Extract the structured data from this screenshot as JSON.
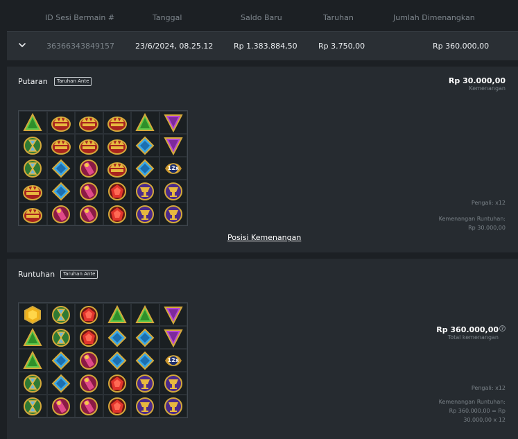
{
  "table": {
    "headers": [
      "ID Sesi Bermain #",
      "Tanggal",
      "Saldo Baru",
      "Taruhan",
      "Jumlah Dimenangkan"
    ],
    "row": {
      "id": "36366343849157",
      "date": "23/6/2024, 08.25.12",
      "balance": "Rp 1.383.884,50",
      "bet": "Rp 3.750,00",
      "won": "Rp 360.000,00"
    }
  },
  "spin": {
    "title": "Putaran",
    "badge": "Taruhan Ante",
    "win_amount": "Rp 30.000,00",
    "win_label": "Kemenangan",
    "multiplier": "Pengali: x12",
    "cascade_label": "Kemenangan Runtuhan:",
    "cascade_value": "Rp 30.000,00",
    "link": "Posisi Kemenangan",
    "grid": [
      [
        "green-triangle",
        "crown",
        "crown",
        "crown",
        "green-triangle",
        "purple-triangle"
      ],
      [
        "hourglass",
        "crown",
        "crown",
        "crown",
        "blue-diamond",
        "purple-triangle"
      ],
      [
        "hourglass",
        "blue-diamond",
        "ring",
        "crown",
        "blue-diamond",
        "multiplier"
      ],
      [
        "crown",
        "blue-diamond",
        "ring",
        "red-gem",
        "chalice",
        "chalice"
      ],
      [
        "crown",
        "ring",
        "ring",
        "red-gem",
        "chalice",
        "chalice"
      ]
    ],
    "multiplier_symbol": "12x"
  },
  "tumble": {
    "title": "Runtuhan",
    "badge": "Taruhan Ante",
    "total_amount": "Rp 360.000,00",
    "total_label": "Total kemenangan",
    "help": "?",
    "multiplier": "Pengali: x12",
    "cascade_label": "Kemenangan Runtuhan:",
    "cascade_line1": "Rp 360.000,00 = Rp",
    "cascade_line2": "30.000,00 x 12",
    "grid": [
      [
        "yellow-gem",
        "hourglass",
        "red-gem",
        "green-triangle",
        "green-triangle",
        "purple-triangle"
      ],
      [
        "green-triangle",
        "hourglass",
        "red-gem",
        "blue-diamond",
        "blue-diamond",
        "purple-triangle"
      ],
      [
        "green-triangle",
        "blue-diamond",
        "ring",
        "blue-diamond",
        "blue-diamond",
        "multiplier"
      ],
      [
        "hourglass",
        "blue-diamond",
        "ring",
        "red-gem",
        "chalice",
        "chalice"
      ],
      [
        "hourglass",
        "ring",
        "ring",
        "red-gem",
        "chalice",
        "chalice"
      ]
    ],
    "multiplier_symbol": "12x"
  },
  "colors": {
    "background": "#1c2024",
    "panel": "#262b30",
    "row": "#2a2f34",
    "muted_text": "#7e868d"
  }
}
